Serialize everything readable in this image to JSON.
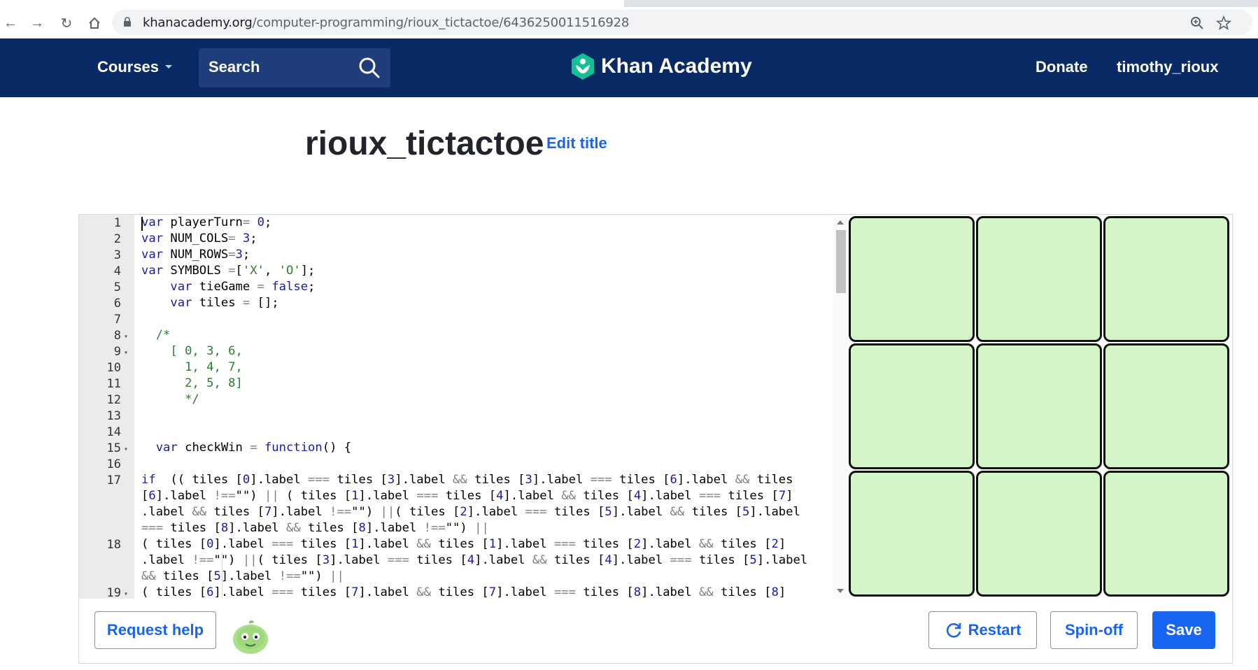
{
  "browser": {
    "url_domain": "khanacademy.org",
    "url_path": "/computer-programming/rioux_tictactoe/6436250011516928"
  },
  "header": {
    "courses_label": "Courses",
    "search_label": "Search",
    "logo_text": "Khan Academy",
    "donate_label": "Donate",
    "username": "timothy_rioux"
  },
  "page": {
    "title": "rioux_tictactoe",
    "edit_title_label": "Edit title"
  },
  "editor": {
    "line_numbers": [
      "1",
      "2",
      "3",
      "4",
      "5",
      "6",
      "7",
      "8",
      "9",
      "10",
      "11",
      "12",
      "13",
      "14",
      "15",
      "16",
      "17",
      "",
      "",
      "",
      "18",
      "",
      "",
      "19"
    ],
    "code_lines": [
      "var playerTurn= 0;",
      "var NUM_COLS= 3;",
      "var NUM_ROWS=3;",
      "var SYMBOLS =['X', 'O'];",
      "    var tieGame = false;",
      "    var tiles = [];",
      "",
      "  /*",
      "    [ 0, 3, 6,",
      "      1, 4, 7,",
      "      2, 5, 8]",
      "      */",
      "",
      "",
      "  var checkWin = function() {",
      "",
      "if  (( tiles [0].label === tiles [3].label && tiles [3].label === tiles [6].label && tiles",
      "[6].label !==\"\") || ( tiles [1].label === tiles [4].label && tiles [4].label === tiles [7]",
      ".label && tiles [7].label !==\"\") ||( tiles [2].label === tiles [5].label && tiles [5].label",
      "=== tiles [8].label && tiles [8].label !==\"\") ||",
      "( tiles [0].label === tiles [1].label && tiles [1].label === tiles [2].label && tiles [2]",
      ".label !==\"\") ||( tiles [3].label === tiles [4].label && tiles [4].label === tiles [5].label",
      "&& tiles [5].label !==\"\") ||",
      "( tiles [6].label === tiles [7].label && tiles [7].label === tiles [8].label && tiles [8]"
    ]
  },
  "canvas": {
    "tile_color": "#d4f5c8",
    "tiles": [
      "",
      "",
      "",
      "",
      "",
      "",
      "",
      "",
      ""
    ]
  },
  "toolbar": {
    "request_help_label": "Request help",
    "restart_label": "Restart",
    "spinoff_label": "Spin-off",
    "save_label": "Save"
  },
  "colors": {
    "header_bg": "#0a2a66",
    "accent": "#1865f2"
  }
}
